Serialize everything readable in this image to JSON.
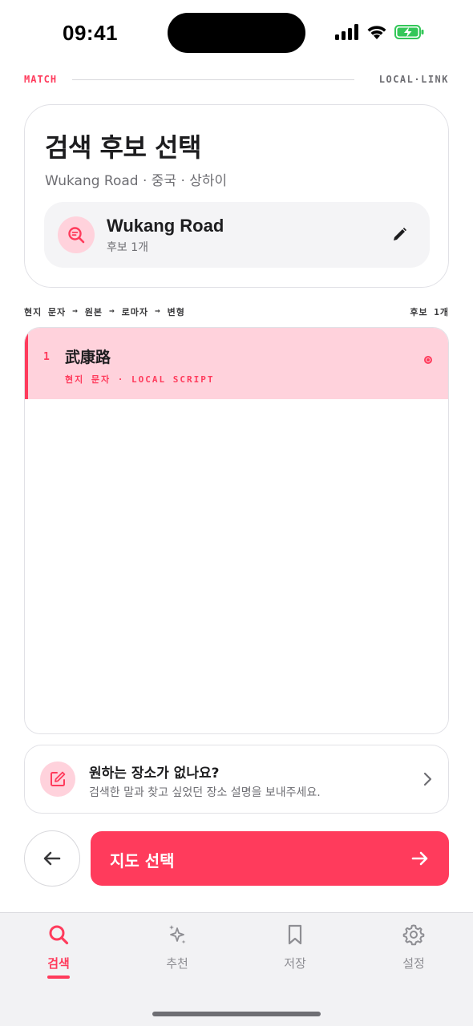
{
  "status_bar": {
    "time": "09:41"
  },
  "header": {
    "brand_left": "MATCH",
    "brand_right": "LOCAL·LINK"
  },
  "search_card": {
    "title": "검색 후보 선택",
    "subtitle": "Wukang Road · 중국 · 상하이",
    "query": {
      "title": "Wukang Road",
      "count": "후보 1개"
    }
  },
  "pipeline": {
    "steps": [
      "현지 문자",
      "원본",
      "로마자",
      "변형"
    ],
    "arrow": "→",
    "candidate_count": "후보 1개"
  },
  "candidates": [
    {
      "number": "1",
      "name": "武康路",
      "meta": "현지 문자 · LOCAL SCRIPT",
      "selected": true
    }
  ],
  "request_card": {
    "title": "원하는 장소가 없나요?",
    "subtitle": "검색한 말과 찾고 싶었던 장소 설명을 보내주세요."
  },
  "actions": {
    "primary_label": "지도 선택"
  },
  "tabs": [
    {
      "label": "검색",
      "icon": "search-icon",
      "active": true
    },
    {
      "label": "추천",
      "icon": "sparkle-icon",
      "active": false
    },
    {
      "label": "저장",
      "icon": "bookmark-icon",
      "active": false
    },
    {
      "label": "설정",
      "icon": "gear-icon",
      "active": false
    }
  ],
  "colors": {
    "accent": "#ff3b5c",
    "accent_soft": "#ffd2dc",
    "battery": "#34c759"
  }
}
